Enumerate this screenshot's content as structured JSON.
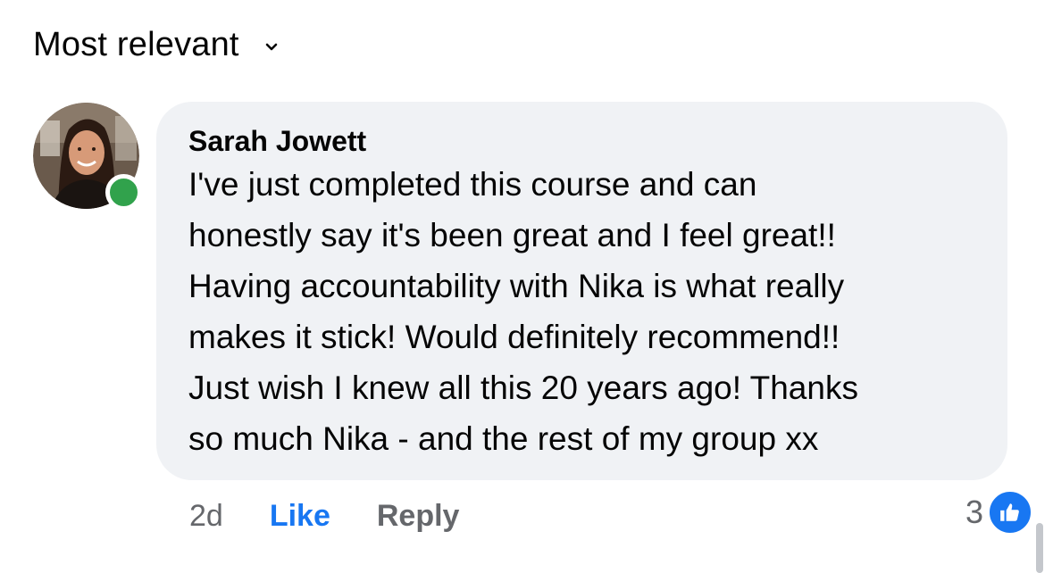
{
  "sort": {
    "label": "Most relevant"
  },
  "comment": {
    "author": "Sarah Jowett",
    "lines": [
      "I've just completed this course and can",
      "honestly say it's been great and I feel great!!",
      "Having accountability with Nika is what really",
      "makes it stick! Would definitely recommend!!",
      "Just wish I knew all this 20 years ago! Thanks",
      "so much Nika - and the rest of my group xx"
    ],
    "timestamp": "2d",
    "like_label": "Like",
    "reply_label": "Reply",
    "reaction_count": "3",
    "reaction_icon": "thumbs-up-icon",
    "presence": "online"
  },
  "colors": {
    "bubble": "#f0f2f5",
    "like_blue": "#1877f2",
    "secondary_text": "#65676b",
    "online_green": "#31a24c"
  }
}
